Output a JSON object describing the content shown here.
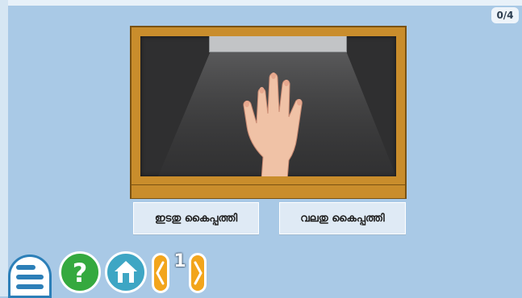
{
  "score": "0/4",
  "choices": {
    "left": "ഇടതു കൈപ്പത്തി",
    "right": "വലതു കൈപ്പത്തി"
  },
  "page_number": "1",
  "icons": {
    "menu": "hamburger-menu-icon",
    "help": "question-mark-icon",
    "home": "home-icon",
    "prev": "chevron-left-icon",
    "next": "chevron-right-icon"
  },
  "colors": {
    "background": "#a9c9e6",
    "board_frame": "#c98d2c",
    "board_surface": "#2f2f30",
    "help": "#35a93f",
    "home": "#3ea6c4",
    "nav": "#f2a51c"
  }
}
